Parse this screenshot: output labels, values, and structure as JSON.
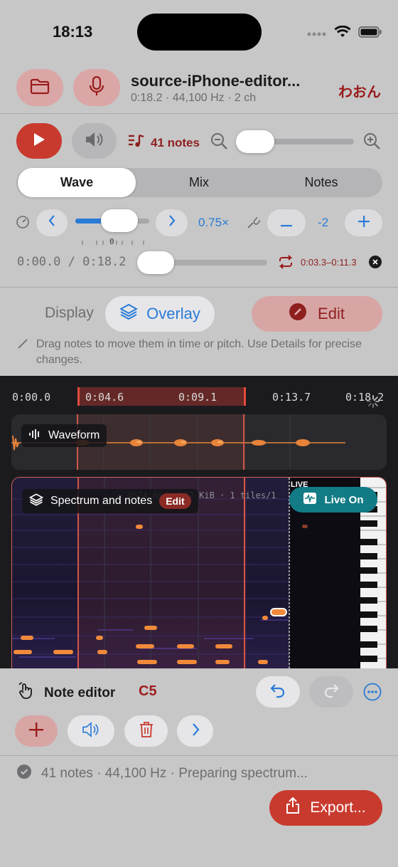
{
  "status_bar": {
    "time": "18:13"
  },
  "header": {
    "title": "source-iPhone-editor...",
    "subtitle": "0:18.2 · 44,100 Hz · 2 ch",
    "brand": "わおん"
  },
  "toolbar": {
    "notes_count": "41 notes"
  },
  "segments": {
    "items": [
      "Wave",
      "Mix",
      "Notes"
    ],
    "selected": "Wave"
  },
  "speed": {
    "value": "0.75×",
    "tick_label": "0",
    "level": 0.55
  },
  "pitch": {
    "value": "-2"
  },
  "playback": {
    "time_display": "0:00.0 / 0:18.2",
    "loop_range": "0:03.3–0:11.3",
    "position": 0.05
  },
  "zoom": {
    "level": 0.12
  },
  "display": {
    "label": "Display",
    "overlay_label": "Overlay",
    "edit_label": "Edit",
    "hint": "Drag notes to move them in time or pitch. Use Details for precise changes."
  },
  "timeline": {
    "ticks": [
      "0:00.0",
      "0:04.6",
      "0:09.1",
      "0:13.7",
      "0:18.2"
    ],
    "waveform_label": "Waveform",
    "spectrum_label": "Spectrum and notes",
    "spectrum_edit": "Edit",
    "debug_text": "4574 ms · 192 KiB · 1 tiles/1",
    "live_tag": "LIVE",
    "live_button": "Live On"
  },
  "editor": {
    "label": "Note editor",
    "selected_note": "C5"
  },
  "footer": {
    "status": "41 notes · 44,100 Hz · Preparing spectrum...",
    "export_label": "Export..."
  },
  "colors": {
    "accent_red": "#c93a2e",
    "accent_blue": "#2a7bd6",
    "live_teal": "#137b85"
  }
}
